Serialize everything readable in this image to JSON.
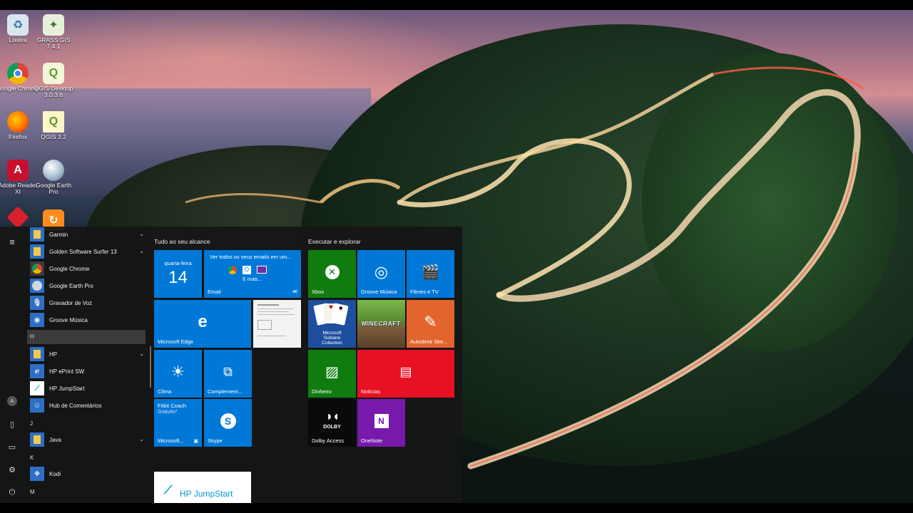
{
  "desktop": {
    "icons": [
      {
        "label": "Lixeira",
        "icon": "recycle-bin-icon"
      },
      {
        "label": "GRASS GIS 7.4.1",
        "icon": "grass-gis-icon"
      },
      {
        "label": "Google Chrome",
        "icon": "chrome-icon"
      },
      {
        "label": "QGIS Desktop 3.0.3.6",
        "icon": "qgis-icon"
      },
      {
        "label": "Firefox",
        "icon": "firefox-icon"
      },
      {
        "label": "QGIS 3.2",
        "icon": "qgis-file-icon"
      },
      {
        "label": "Adobe Reader XI",
        "icon": "adobe-reader-icon"
      },
      {
        "label": "Google Earth Pro",
        "icon": "google-earth-icon"
      }
    ]
  },
  "start_menu": {
    "app_list": [
      {
        "type": "app",
        "label": "Garmin",
        "icon": "folder-icon",
        "chevron": true
      },
      {
        "type": "app",
        "label": "Golden Software Surfer 13",
        "icon": "folder-icon",
        "chevron": true
      },
      {
        "type": "app",
        "label": "Google Chrome",
        "icon": "chrome-icon"
      },
      {
        "type": "app",
        "label": "Google Earth Pro",
        "icon": "google-earth-icon"
      },
      {
        "type": "app",
        "label": "Gravador de Voz",
        "icon": "microphone-icon"
      },
      {
        "type": "app",
        "label": "Groove Música",
        "icon": "groove-music-icon"
      },
      {
        "type": "letter",
        "label": "H"
      },
      {
        "type": "app",
        "label": "HP",
        "icon": "folder-icon",
        "chevron": true
      },
      {
        "type": "app",
        "label": "HP ePrint SW",
        "icon": "hp-eprint-icon"
      },
      {
        "type": "app",
        "label": "HP JumpStart",
        "icon": "hp-jumpstart-icon"
      },
      {
        "type": "app",
        "label": "Hub de Comentários",
        "icon": "feedback-hub-icon"
      },
      {
        "type": "letter",
        "label": "J"
      },
      {
        "type": "app",
        "label": "Java",
        "icon": "folder-icon",
        "chevron": true
      },
      {
        "type": "letter",
        "label": "K"
      },
      {
        "type": "app",
        "label": "Kodi",
        "icon": "kodi-icon"
      },
      {
        "type": "letter",
        "label": "M"
      }
    ],
    "group1_title": "Tudo ao seu alcance",
    "group2_title": "Executar e explorar",
    "calendar": {
      "day_name": "quarta-feira",
      "day_number": "14"
    },
    "email": {
      "text": "Ver todos os seus emails em um...",
      "more": "E mais...",
      "label": "Email"
    },
    "edge": {
      "label": "Microsoft Edge"
    },
    "weather": {
      "label": "Clima"
    },
    "complements": {
      "label": "Complement..."
    },
    "fitbit": {
      "title": "Fitbit Coach",
      "subtitle": "Gratuito*",
      "label": "Microsoft..."
    },
    "skype": {
      "label": "Skype"
    },
    "hp_jumpstart_tile": {
      "label": "HP JumpStart"
    },
    "xbox": {
      "label": "Xbox"
    },
    "groove": {
      "label": "Groove Música"
    },
    "films": {
      "label": "Filmes e TV"
    },
    "solitaire": {
      "label": "Microsoft Solitaire Collection"
    },
    "minecraft": {
      "label": "MINECRAFT"
    },
    "autodesk": {
      "label": "Autodesk Ske..."
    },
    "money": {
      "label": "Dinheiro"
    },
    "news": {
      "label": "Notícias"
    },
    "dolby": {
      "logo": "DOLBY",
      "label": "Dolby Access"
    },
    "onenote": {
      "label": "OneNote"
    },
    "rail_letter": "A"
  }
}
